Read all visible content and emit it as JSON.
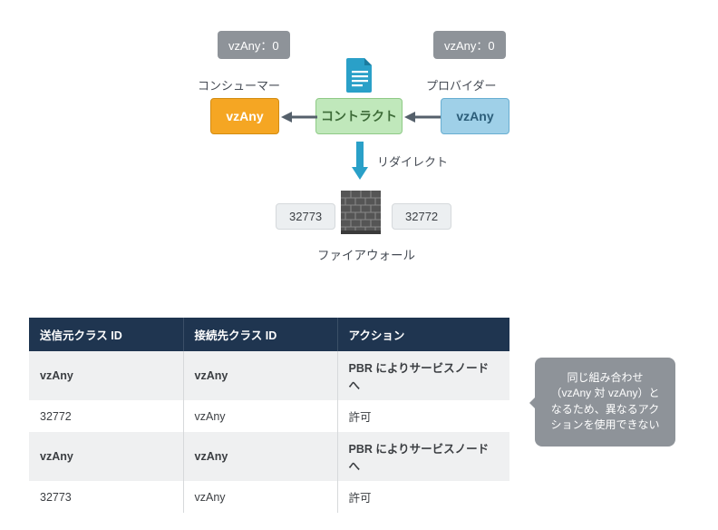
{
  "badges": {
    "left": "vzAny：0",
    "right": "vzAny：0"
  },
  "labels": {
    "consumer": "コンシューマー",
    "provider": "プロバイダー",
    "redirect": "リダイレクト",
    "firewall": "ファイアウォール"
  },
  "boxes": {
    "consumer_vzany": "vzAny",
    "contract": "コントラクト",
    "provider_vzany": "vzAny"
  },
  "ports": {
    "left": "32773",
    "right": "32772"
  },
  "table": {
    "headers": {
      "src": "送信元クラス ID",
      "dst": "接続先クラス ID",
      "act": "アクション"
    },
    "rows": [
      {
        "src": "vzAny",
        "dst": "vzAny",
        "act": "PBR によりサービスノードへ",
        "emph": true
      },
      {
        "src": "32772",
        "dst": "vzAny",
        "act": "許可",
        "emph": false
      },
      {
        "src": "vzAny",
        "dst": "vzAny",
        "act": "PBR によりサービスノードへ",
        "emph": true
      },
      {
        "src": "32773",
        "dst": "vzAny",
        "act": "許可",
        "emph": false
      }
    ]
  },
  "callout": "同じ組み合わせ（vzAny 対 vzAny）となるため、異なるアクションを使用できない"
}
